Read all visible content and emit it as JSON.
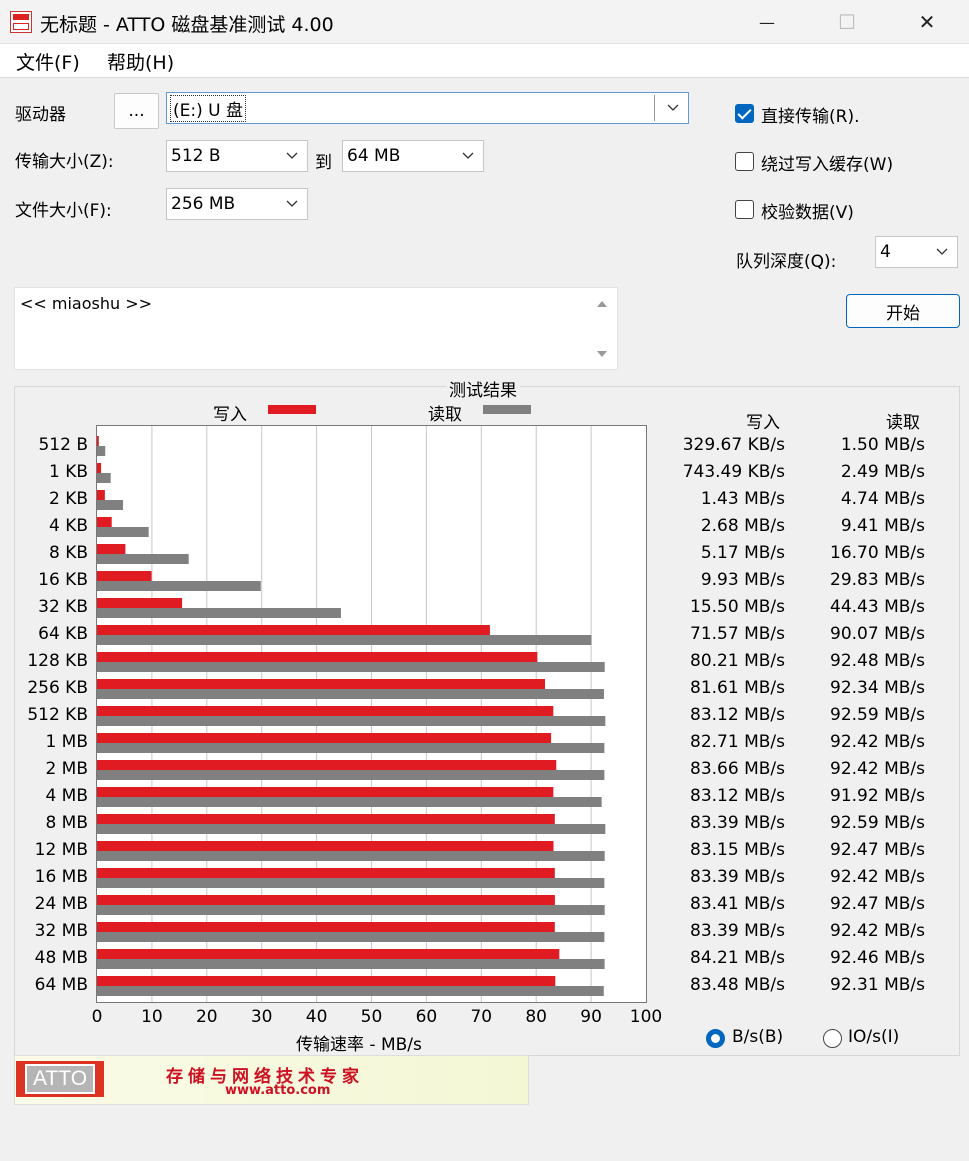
{
  "window": {
    "title": "无标题 - ATTO 磁盘基准测试 4.00",
    "minimize": "—",
    "maximize": "☐",
    "close": "✕"
  },
  "menu": {
    "file": "文件(F)",
    "help": "帮助(H)"
  },
  "form": {
    "drive_label": "驱动器",
    "browse_label": "...",
    "drive_value": "(E:) U 盘",
    "transfer_label": "传输大小(Z):",
    "transfer_from": "512 B",
    "to_label": "到",
    "transfer_to": "64 MB",
    "file_size_label": "文件大小(F):",
    "file_size": "256 MB",
    "direct_io": {
      "label": "直接传输(R).",
      "checked": true
    },
    "bypass_cache": {
      "label": "绕过写入缓存(W)",
      "checked": false
    },
    "verify": {
      "label": "校验数据(V)",
      "checked": false
    },
    "queue_label": "队列深度(Q):",
    "queue_value": "4",
    "start_label": "开始",
    "description": "<< miaoshu >>"
  },
  "results": {
    "title": "测试结果",
    "legend_write": "写入",
    "legend_read": "读取",
    "col_write": "写入",
    "col_read": "读取",
    "write_values": [
      "329.67 KB/s",
      "743.49 KB/s",
      "1.43 MB/s",
      "2.68 MB/s",
      "5.17 MB/s",
      "9.93 MB/s",
      "15.50 MB/s",
      "71.57 MB/s",
      "80.21 MB/s",
      "81.61 MB/s",
      "83.12 MB/s",
      "82.71 MB/s",
      "83.66 MB/s",
      "83.12 MB/s",
      "83.39 MB/s",
      "83.15 MB/s",
      "83.39 MB/s",
      "83.41 MB/s",
      "83.39 MB/s",
      "84.21 MB/s",
      "83.48 MB/s"
    ],
    "read_values": [
      "1.50 MB/s",
      "2.49 MB/s",
      "4.74 MB/s",
      "9.41 MB/s",
      "16.70 MB/s",
      "29.83 MB/s",
      "44.43 MB/s",
      "90.07 MB/s",
      "92.48 MB/s",
      "92.34 MB/s",
      "92.59 MB/s",
      "92.42 MB/s",
      "92.42 MB/s",
      "91.92 MB/s",
      "92.59 MB/s",
      "92.47 MB/s",
      "92.42 MB/s",
      "92.47 MB/s",
      "92.42 MB/s",
      "92.46 MB/s",
      "92.31 MB/s"
    ],
    "unit_bytes": {
      "label": "B/s(B)",
      "checked": true
    },
    "unit_io": {
      "label": "IO/s(I)",
      "checked": false
    }
  },
  "chart_data": {
    "type": "bar",
    "orientation": "horizontal",
    "xlabel": "传输速率 - MB/s",
    "xlim": [
      0,
      100
    ],
    "x_ticks": [
      "0",
      "10",
      "20",
      "30",
      "40",
      "50",
      "60",
      "70",
      "80",
      "90",
      "100"
    ],
    "categories": [
      "512 B",
      "1 KB",
      "2 KB",
      "4 KB",
      "8 KB",
      "16 KB",
      "32 KB",
      "64 KB",
      "128 KB",
      "256 KB",
      "512 KB",
      "1 MB",
      "2 MB",
      "4 MB",
      "8 MB",
      "12 MB",
      "16 MB",
      "24 MB",
      "32 MB",
      "48 MB",
      "64 MB"
    ],
    "series": [
      {
        "name": "写入",
        "color": "#e11b22",
        "values": [
          0.33,
          0.74,
          1.43,
          2.68,
          5.17,
          9.93,
          15.5,
          71.57,
          80.21,
          81.61,
          83.12,
          82.71,
          83.66,
          83.12,
          83.39,
          83.15,
          83.39,
          83.41,
          83.39,
          84.21,
          83.48
        ]
      },
      {
        "name": "读取",
        "color": "#808080",
        "values": [
          1.5,
          2.49,
          4.74,
          9.41,
          16.7,
          29.83,
          44.43,
          90.07,
          92.48,
          92.34,
          92.59,
          92.42,
          92.42,
          91.92,
          92.59,
          92.47,
          92.42,
          92.47,
          92.42,
          92.46,
          92.31
        ]
      }
    ],
    "legend_position": "top",
    "grid": true
  },
  "banner": {
    "logo": "ATTO",
    "slogan": "存储与网络技术专家",
    "url": "www.atto.com"
  }
}
